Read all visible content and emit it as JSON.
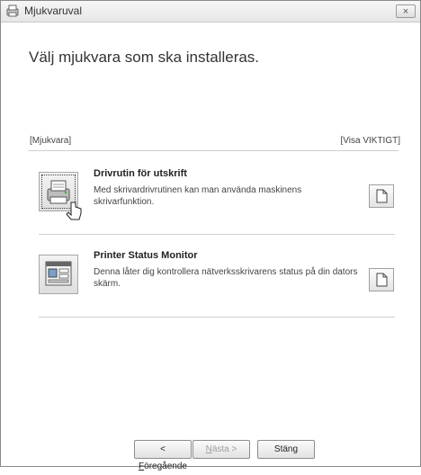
{
  "window": {
    "title": "Mjukvaruval",
    "close_glyph": "×"
  },
  "heading": "Välj mjukvara som ska installeras.",
  "list": {
    "header_left": "[Mjukvara]",
    "header_right": "[Visa VIKTIGT]",
    "items": [
      {
        "title": "Drivrutin för utskrift",
        "description": "Med skrivardrivrutinen kan man använda maskinens skrivarfunktion.",
        "icon": "printer-icon",
        "doc_icon": "document-icon"
      },
      {
        "title": "Printer Status Monitor",
        "description": "Denna låter dig kontrollera nätverksskrivarens status på din dators skärm.",
        "icon": "status-monitor-icon",
        "doc_icon": "document-icon"
      }
    ]
  },
  "buttons": {
    "back": {
      "prefix": "< ",
      "mnemonic": "F",
      "rest": "öregående"
    },
    "next": {
      "mnemonic": "N",
      "rest": "ästa >"
    },
    "close": "Stäng"
  }
}
